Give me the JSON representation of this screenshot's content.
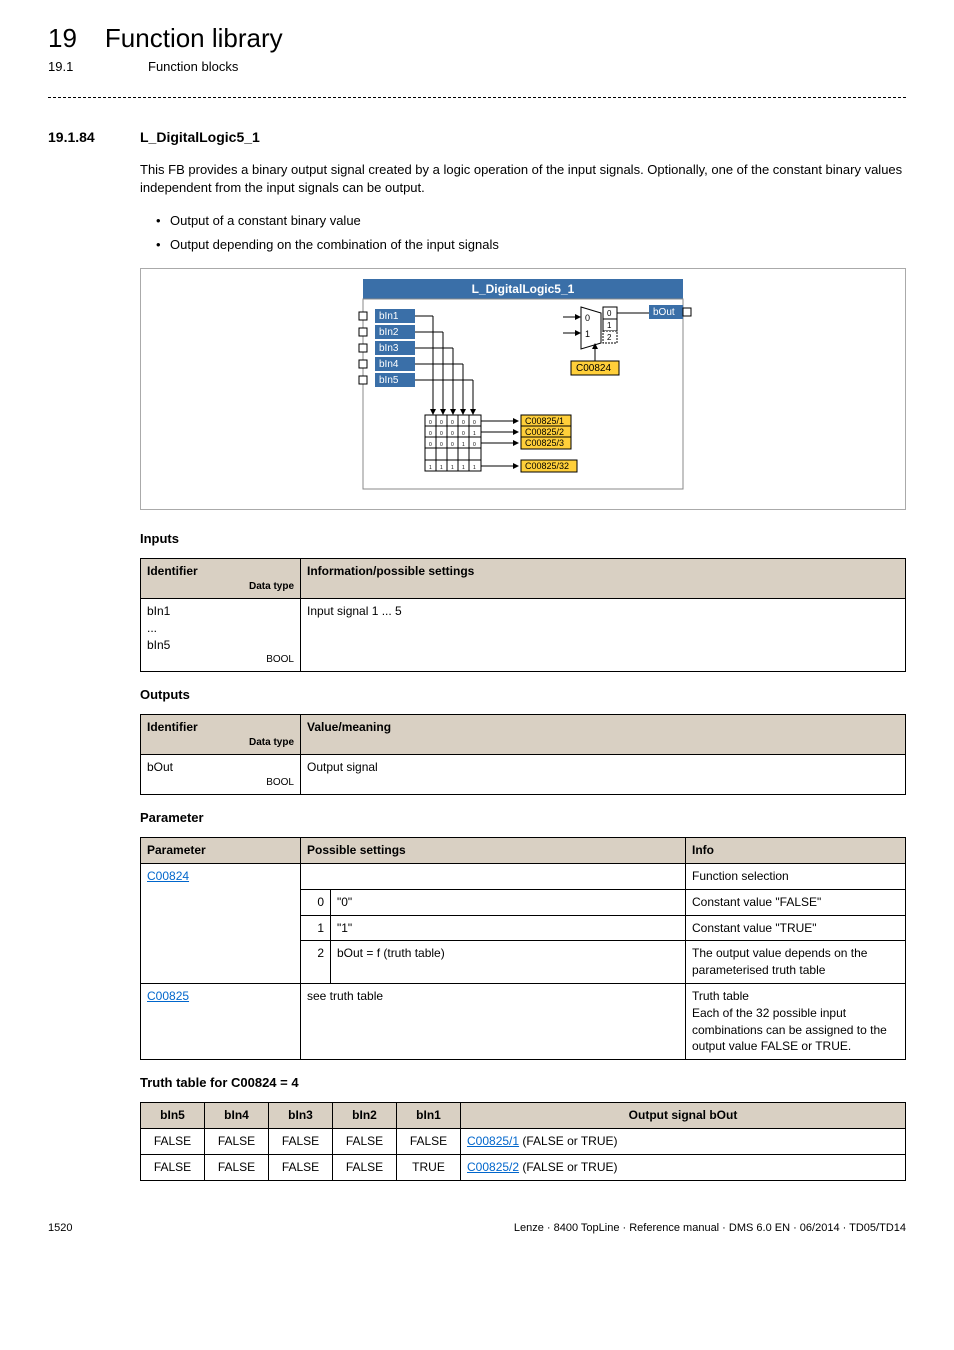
{
  "header": {
    "chapter_num": "19",
    "chapter_title": "Function library",
    "sub_num": "19.1",
    "sub_title": "Function blocks"
  },
  "section": {
    "num": "19.1.84",
    "title": "L_DigitalLogic5_1"
  },
  "intro": "This FB provides a binary output signal created by a logic operation of the input signals. Optionally, one of the constant binary values independent from the input signals can be output.",
  "bullets": [
    "Output of a constant binary value",
    "Output depending on the combination of the input signals"
  ],
  "diagram": {
    "title": "L_DigitalLogic5_1",
    "inputs": [
      "bIn1",
      "bIn2",
      "bIn3",
      "bIn4",
      "bIn5"
    ],
    "output": "bOut",
    "mux_labels": [
      "0",
      "1"
    ],
    "mux_options": [
      "0",
      "1",
      "2"
    ],
    "code_main": "C00824",
    "codes": [
      "C00825/1",
      "C00825/2",
      "C00825/3",
      "C00825/32"
    ]
  },
  "inputs_heading": "Inputs",
  "inputs_table": {
    "h1": "Identifier",
    "h1_sub": "Data type",
    "h2": "Information/possible settings",
    "row1_id": "bIn1\n...\nbIn5",
    "row1_dt": "BOOL",
    "row1_info": "Input signal 1 ... 5"
  },
  "outputs_heading": "Outputs",
  "outputs_table": {
    "h1": "Identifier",
    "h1_sub": "Data type",
    "h2": "Value/meaning",
    "row1_id": "bOut",
    "row1_dt": "BOOL",
    "row1_info": "Output signal"
  },
  "param_heading": "Parameter",
  "param_table": {
    "h1": "Parameter",
    "h2": "Possible settings",
    "h3": "Info",
    "rows": [
      {
        "param": "C00824",
        "is_link": true,
        "ps_left": "",
        "ps_right": "",
        "info": "Function selection"
      },
      {
        "param": "",
        "ps_left": "0",
        "ps_right": "\"0\"",
        "info": "Constant value \"FALSE\""
      },
      {
        "param": "",
        "ps_left": "1",
        "ps_right": "\"1\"",
        "info": "Constant value \"TRUE\""
      },
      {
        "param": "",
        "ps_left": "2",
        "ps_right": "bOut = f (truth table)",
        "info": "The output value depends on the parameterised truth table"
      },
      {
        "param": "C00825",
        "is_link": true,
        "ps_span": "see truth table",
        "info": "Truth table\nEach of the 32 possible input combinations can be assigned to the output value FALSE or TRUE."
      }
    ]
  },
  "truth_heading": "Truth table for C00824 = 4",
  "truth_table": {
    "headers": [
      "bIn5",
      "bIn4",
      "bIn3",
      "bIn2",
      "bIn1",
      "Output signal bOut"
    ],
    "rows": [
      [
        "FALSE",
        "FALSE",
        "FALSE",
        "FALSE",
        "FALSE",
        {
          "link": "C00825/1",
          "suffix": " (FALSE or TRUE)"
        }
      ],
      [
        "FALSE",
        "FALSE",
        "FALSE",
        "FALSE",
        "TRUE",
        {
          "link": "C00825/2",
          "suffix": " (FALSE or TRUE)"
        }
      ]
    ]
  },
  "footer": {
    "page": "1520",
    "right": "Lenze · 8400 TopLine · Reference manual · DMS 6.0 EN · 06/2014 · TD05/TD14"
  }
}
